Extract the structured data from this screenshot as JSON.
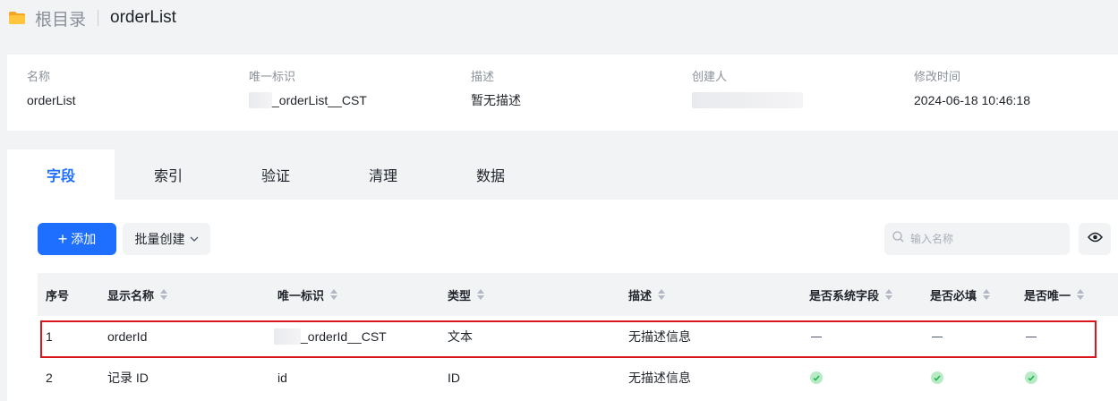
{
  "breadcrumb": {
    "root": "根目录",
    "current": "orderList"
  },
  "info": {
    "name_label": "名称",
    "name_value": "orderList",
    "uid_label": "唯一标识",
    "uid_value": "_orderList__CST",
    "desc_label": "描述",
    "desc_value": "暂无描述",
    "creator_label": "创建人",
    "modified_label": "修改时间",
    "modified_value": "2024-06-18 10:46:18"
  },
  "tabs": [
    {
      "label": "字段",
      "active": true
    },
    {
      "label": "索引",
      "active": false
    },
    {
      "label": "验证",
      "active": false
    },
    {
      "label": "清理",
      "active": false
    },
    {
      "label": "数据",
      "active": false
    }
  ],
  "toolbar": {
    "add_label": "添加",
    "batch_label": "批量创建",
    "search_placeholder": "输入名称"
  },
  "table": {
    "headers": [
      "序号",
      "显示名称",
      "唯一标识",
      "类型",
      "描述",
      "是否系统字段",
      "是否必填",
      "是否唯一"
    ],
    "rows": [
      {
        "index": "1",
        "display_name": "orderId",
        "uid": "_orderId__CST",
        "type": "文本",
        "desc": "无描述信息",
        "system": "dash",
        "required": "dash",
        "unique": "dash"
      },
      {
        "index": "2",
        "display_name": "记录 ID",
        "uid": "id",
        "type": "ID",
        "desc": "无描述信息",
        "system": "check",
        "required": "check",
        "unique": "check"
      }
    ]
  },
  "colors": {
    "accent": "#1e6fff",
    "highlight_border": "#d9161b",
    "check_green": "#23b04c"
  }
}
